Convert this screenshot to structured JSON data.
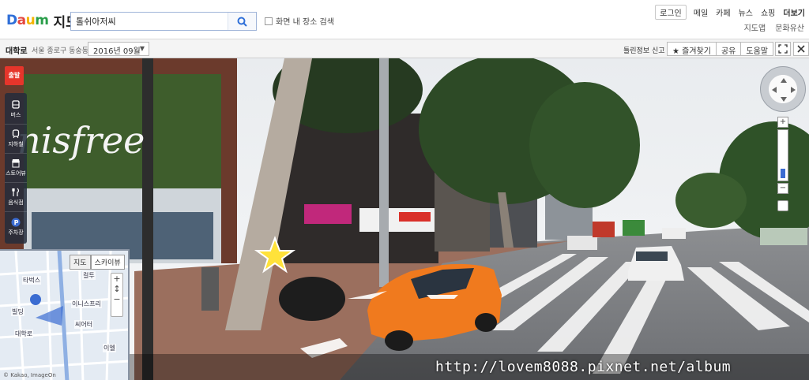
{
  "header": {
    "logo_brand": "Daum",
    "logo_map": "지도",
    "search_value": "톨쉬아저씨",
    "checkbox_label": "화면 내 장소 검색",
    "gnb": [
      "로그인",
      "메일",
      "카페",
      "뉴스",
      "쇼핑",
      "더보기"
    ],
    "sub_gnb": [
      "지도앱",
      "문화유산"
    ]
  },
  "roadview_bar": {
    "road_name": "대학로",
    "address": "서울 종로구 동숭동",
    "date": "2016년 09월",
    "report": "틀린정보 신고",
    "buttons": [
      "즐겨찾기",
      "공유",
      "도움말"
    ]
  },
  "toolbar": {
    "start": "출발",
    "items": [
      {
        "label": "버스",
        "icon": "bus-icon"
      },
      {
        "label": "지하철",
        "icon": "subway-icon"
      },
      {
        "label": "스토어뷰",
        "icon": "store-icon"
      },
      {
        "label": "음식점",
        "icon": "restaurant-icon"
      },
      {
        "label": "주차장",
        "icon": "parking-icon"
      }
    ]
  },
  "minimap": {
    "toggle": [
      "지도",
      "스카이뷰"
    ],
    "labels": [
      "타벅스",
      "컬투",
      "빌딩",
      "이니스프리",
      "씨어터",
      "이엘",
      "대학로"
    ],
    "copyright": "© Kakao, ImageOn"
  },
  "scene": {
    "store_sign": "nisfree"
  },
  "watermark": "http://lovem8088.pixnet.net/album",
  "colors": {
    "brand_blue": "#2f6fd8",
    "start_red": "#e6352b",
    "taxi_orange": "#f07a1e"
  }
}
